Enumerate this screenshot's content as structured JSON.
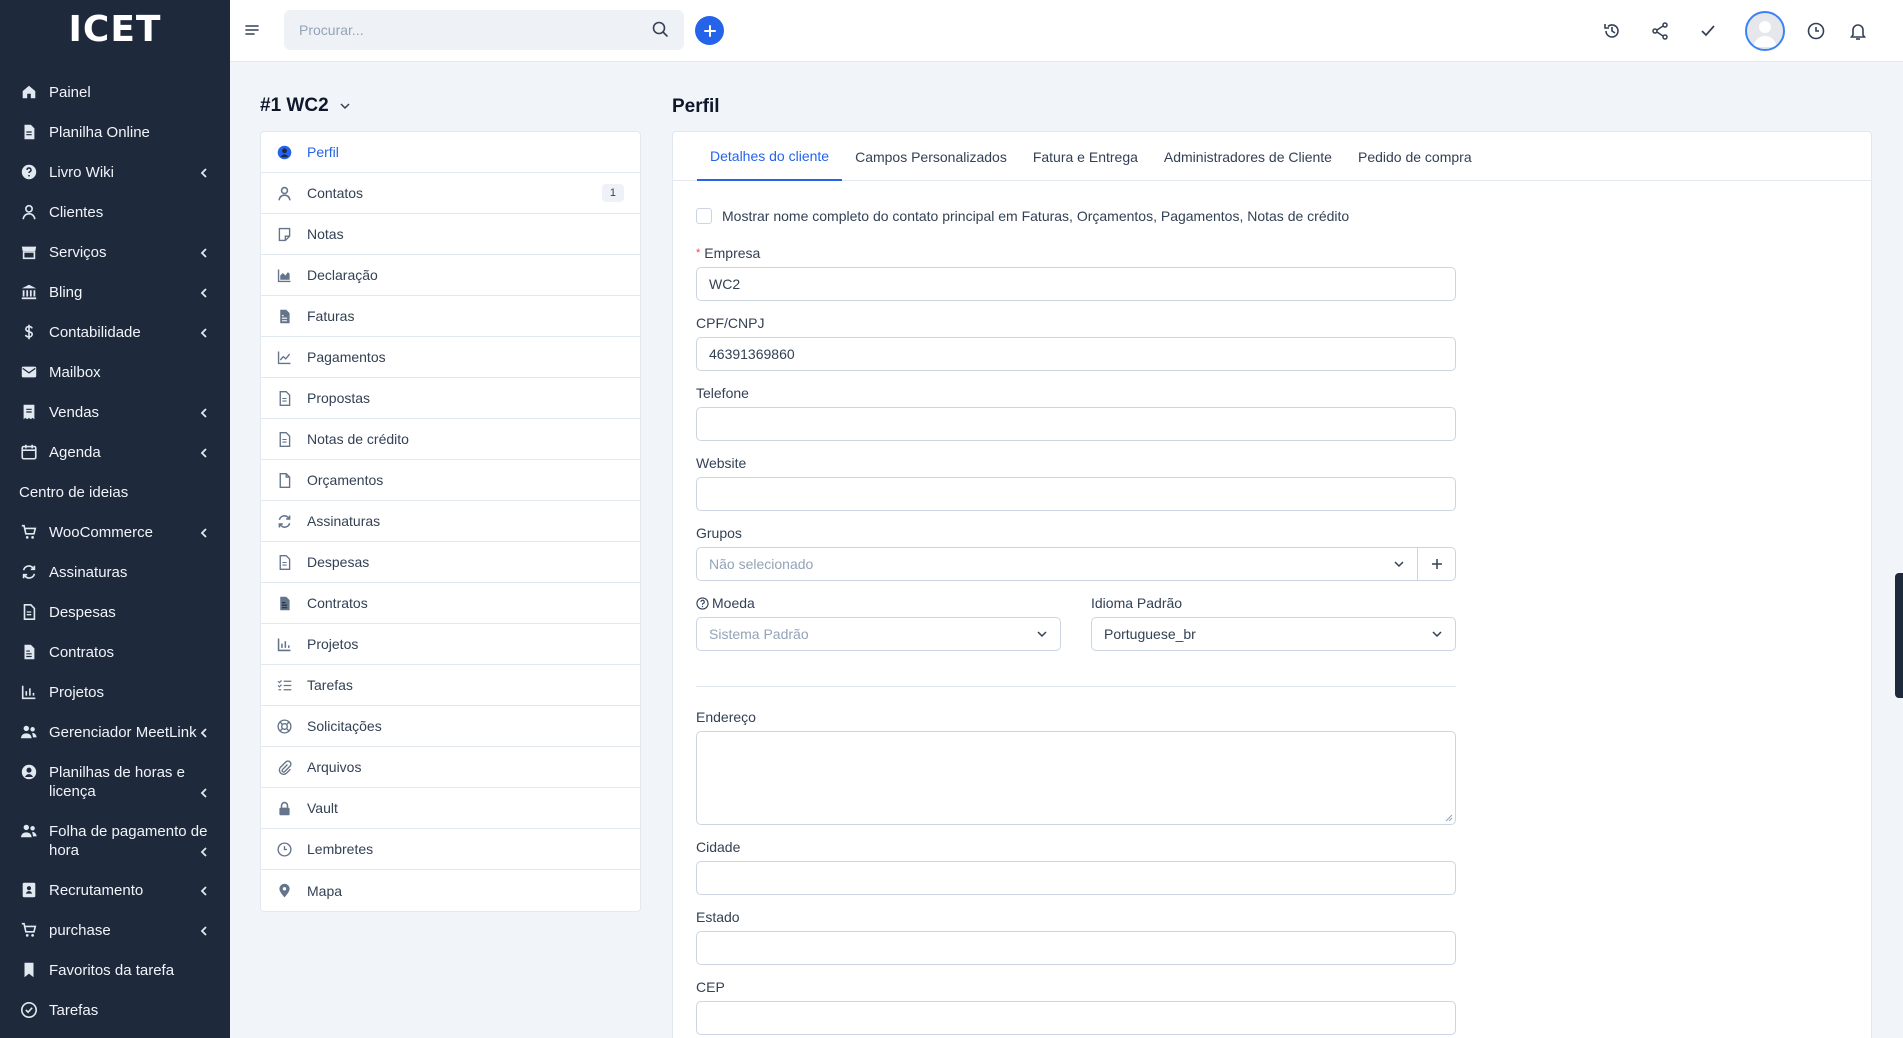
{
  "app": {
    "logo": "ICET"
  },
  "sidebar": {
    "items": [
      {
        "label": "Painel",
        "icon": "home-icon",
        "chevron": false
      },
      {
        "label": "Planilha Online",
        "icon": "file-icon",
        "chevron": false
      },
      {
        "label": "Livro Wiki",
        "icon": "help-circle-icon",
        "chevron": true
      },
      {
        "label": "Clientes",
        "icon": "user-icon",
        "chevron": false
      },
      {
        "label": "Serviços",
        "icon": "shop-icon",
        "chevron": true
      },
      {
        "label": "Bling",
        "icon": "bank-icon",
        "chevron": true
      },
      {
        "label": "Contabilidade",
        "icon": "dollar-icon",
        "chevron": true
      },
      {
        "label": "Mailbox",
        "icon": "mail-icon",
        "chevron": false
      },
      {
        "label": "Vendas",
        "icon": "receipt-icon",
        "chevron": true
      },
      {
        "label": "Agenda",
        "icon": "calendar-icon",
        "chevron": true
      },
      {
        "label": "Centro de ideias",
        "icon": "",
        "chevron": false
      },
      {
        "label": "WooCommerce",
        "icon": "cart-icon",
        "chevron": true
      },
      {
        "label": "Assinaturas",
        "icon": "repeat-icon",
        "chevron": false
      },
      {
        "label": "Despesas",
        "icon": "file-text-icon",
        "chevron": false
      },
      {
        "label": "Contratos",
        "icon": "contract-icon",
        "chevron": false
      },
      {
        "label": "Projetos",
        "icon": "chart-bar-icon",
        "chevron": false
      },
      {
        "label": "Gerenciador MeetLink",
        "icon": "users-icon",
        "chevron": true
      },
      {
        "label": "Planilhas de horas e licença",
        "icon": "user-circle-icon",
        "chevron": true
      },
      {
        "label": "Folha de pagamento de hora",
        "icon": "users-icon",
        "chevron": true
      },
      {
        "label": "Recrutamento",
        "icon": "id-card-icon",
        "chevron": true
      },
      {
        "label": "purchase",
        "icon": "cart-icon",
        "chevron": true
      },
      {
        "label": "Favoritos da tarefa",
        "icon": "bookmark-icon",
        "chevron": false
      },
      {
        "label": "Tarefas",
        "icon": "check-circle-icon",
        "chevron": false
      }
    ]
  },
  "topbar": {
    "search_placeholder": "Procurar..."
  },
  "client": {
    "title": "#1 WC2"
  },
  "subnav": {
    "items": [
      {
        "label": "Perfil",
        "icon": "user-circle-icon",
        "active": true,
        "badge": ""
      },
      {
        "label": "Contatos",
        "icon": "user-icon",
        "active": false,
        "badge": "1"
      },
      {
        "label": "Notas",
        "icon": "note-icon",
        "active": false,
        "badge": ""
      },
      {
        "label": "Declaração",
        "icon": "area-chart-icon",
        "active": false,
        "badge": ""
      },
      {
        "label": "Faturas",
        "icon": "invoice-icon",
        "active": false,
        "badge": ""
      },
      {
        "label": "Pagamentos",
        "icon": "line-chart-icon",
        "active": false,
        "badge": ""
      },
      {
        "label": "Propostas",
        "icon": "document-icon",
        "active": false,
        "badge": ""
      },
      {
        "label": "Notas de crédito",
        "icon": "document-icon",
        "active": false,
        "badge": ""
      },
      {
        "label": "Orçamentos",
        "icon": "blank-file-icon",
        "active": false,
        "badge": ""
      },
      {
        "label": "Assinaturas",
        "icon": "repeat-icon",
        "active": false,
        "badge": ""
      },
      {
        "label": "Despesas",
        "icon": "document-icon",
        "active": false,
        "badge": ""
      },
      {
        "label": "Contratos",
        "icon": "contract-icon",
        "active": false,
        "badge": ""
      },
      {
        "label": "Projetos",
        "icon": "chart-bar-icon",
        "active": false,
        "badge": ""
      },
      {
        "label": "Tarefas",
        "icon": "list-check-icon",
        "active": false,
        "badge": ""
      },
      {
        "label": "Solicitações",
        "icon": "lifebuoy-icon",
        "active": false,
        "badge": ""
      },
      {
        "label": "Arquivos",
        "icon": "paperclip-icon",
        "active": false,
        "badge": ""
      },
      {
        "label": "Vault",
        "icon": "lock-icon",
        "active": false,
        "badge": ""
      },
      {
        "label": "Lembretes",
        "icon": "clock-icon",
        "active": false,
        "badge": ""
      },
      {
        "label": "Mapa",
        "icon": "map-pin-icon",
        "active": false,
        "badge": ""
      }
    ]
  },
  "panel": {
    "title": "Perfil",
    "tabs": [
      {
        "label": "Detalhes do cliente",
        "active": true
      },
      {
        "label": "Campos Personalizados",
        "active": false
      },
      {
        "label": "Fatura e Entrega",
        "active": false
      },
      {
        "label": "Administradores de Cliente",
        "active": false
      },
      {
        "label": "Pedido de compra",
        "active": false
      }
    ],
    "checkbox_label": "Mostrar nome completo do contato principal em Faturas, Orçamentos, Pagamentos, Notas de crédito",
    "fields": {
      "empresa": {
        "label": "Empresa",
        "value": "WC2"
      },
      "cpf": {
        "label": "CPF/CNPJ",
        "value": "46391369860"
      },
      "telefone": {
        "label": "Telefone",
        "value": ""
      },
      "website": {
        "label": "Website",
        "value": ""
      },
      "grupos": {
        "label": "Grupos",
        "placeholder": "Não selecionado"
      },
      "moeda": {
        "label": "Moeda",
        "placeholder": "Sistema Padrão"
      },
      "idioma": {
        "label": "Idioma Padrão",
        "value": "Portuguese_br"
      },
      "endereco": {
        "label": "Endereço",
        "value": ""
      },
      "cidade": {
        "label": "Cidade",
        "value": ""
      },
      "estado": {
        "label": "Estado",
        "value": ""
      },
      "cep": {
        "label": "CEP",
        "value": ""
      }
    }
  },
  "colors": {
    "accent": "#2563eb",
    "sidebar_bg": "#1e293b"
  }
}
